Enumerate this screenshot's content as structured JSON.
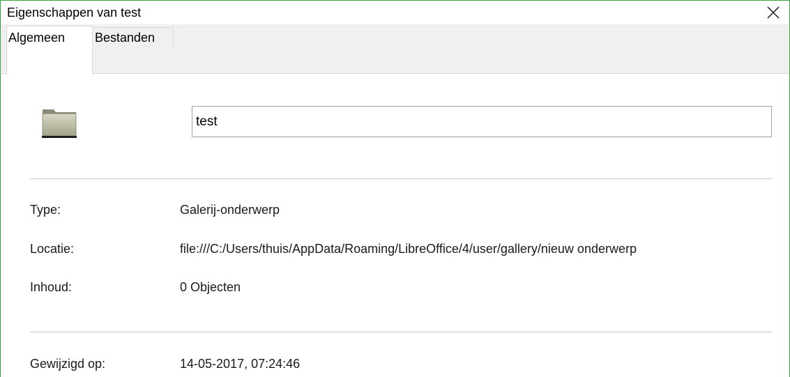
{
  "window": {
    "title": "Eigenschappen van test",
    "accent_color": "#3aa13a"
  },
  "tabs": [
    {
      "label": "Algemeen",
      "active": true
    },
    {
      "label": "Bestanden",
      "active": false
    }
  ],
  "general": {
    "icon": "folder-icon",
    "name_value": "test",
    "fields": {
      "type_label": "Type:",
      "type_value": "Galerij-onderwerp",
      "location_label": "Locatie:",
      "location_value": "file:///C:/Users/thuis/AppData/Roaming/LibreOffice/4/user/gallery/nieuw onderwerp",
      "contents_label": "Inhoud:",
      "contents_value": "0 Objecten",
      "modified_label": "Gewijzigd op:",
      "modified_value": "14-05-2017, 07:24:46"
    }
  }
}
